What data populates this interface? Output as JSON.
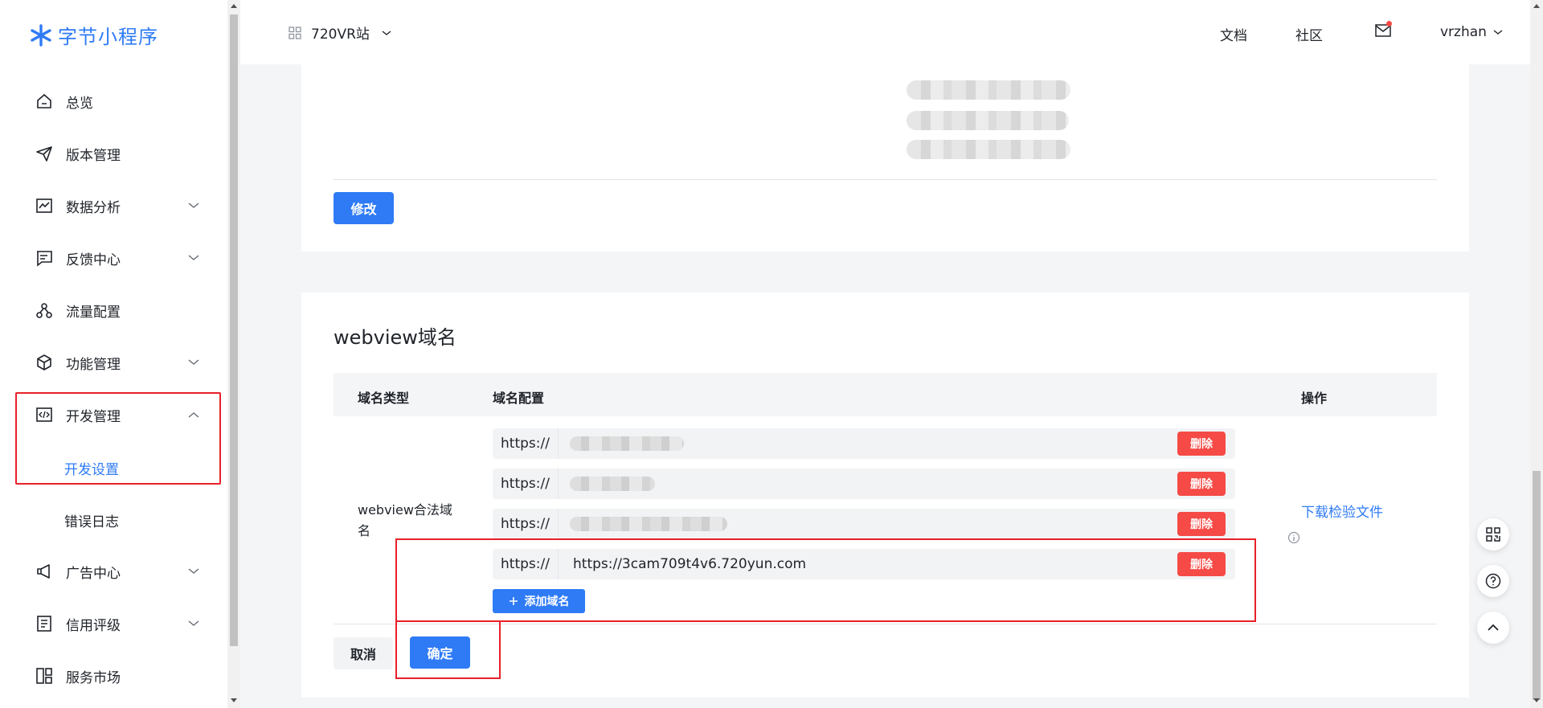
{
  "brand": {
    "name": "字节小程序",
    "color": "#2f7bf6"
  },
  "header": {
    "app_name": "720VR站",
    "links": {
      "docs": "文档",
      "community": "社区"
    },
    "user": "vrzhan"
  },
  "sidebar": {
    "items": [
      {
        "label": "总览",
        "icon": "home-icon"
      },
      {
        "label": "版本管理",
        "icon": "send-icon"
      },
      {
        "label": "数据分析",
        "icon": "chart-icon"
      },
      {
        "label": "反馈中心",
        "icon": "feedback-icon"
      },
      {
        "label": "流量配置",
        "icon": "flow-icon"
      },
      {
        "label": "功能管理",
        "icon": "cube-icon"
      },
      {
        "label": "开发管理",
        "icon": "code-icon"
      },
      {
        "label": "广告中心",
        "icon": "megaphone-icon"
      },
      {
        "label": "信用评级",
        "icon": "list-icon"
      },
      {
        "label": "服务市场",
        "icon": "grid-icon"
      }
    ],
    "sub_items": {
      "dev_settings": "开发设置",
      "error_log": "错误日志"
    }
  },
  "top_card": {
    "modify_label": "修改"
  },
  "webview": {
    "title": "webview域名",
    "columns": {
      "type": "域名类型",
      "config": "域名配置",
      "ops": "操作"
    },
    "row_label": "webview合法域名",
    "prefix": "https://",
    "domains": [
      "",
      "",
      "",
      "https://3cam709t4v6.720yun.com"
    ],
    "delete_label": "删除",
    "add_label": "添加域名",
    "download_label": "下载检验文件",
    "cancel_label": "取消",
    "confirm_label": "确定"
  },
  "colors": {
    "primary": "#2f7bf6",
    "danger": "#f54a45",
    "highlight": "#e8202a"
  }
}
